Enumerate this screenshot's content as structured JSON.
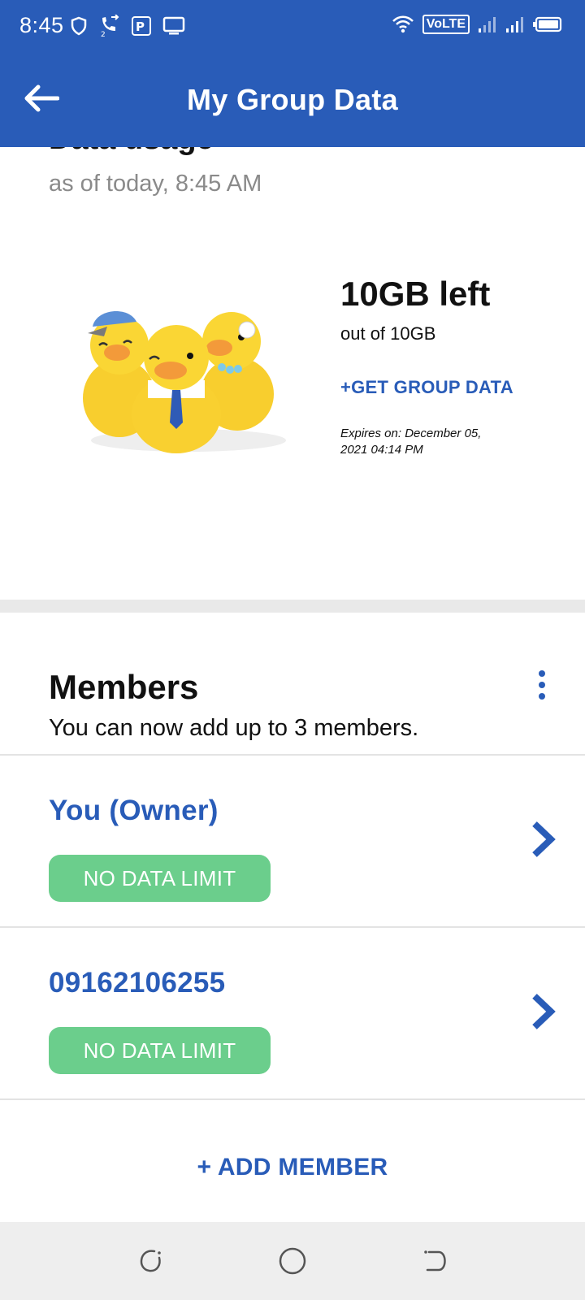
{
  "status_bar": {
    "time": "8:45",
    "left_icons": [
      "shield-icon",
      "call-forward-icon",
      "parking-icon",
      "screen-icon"
    ],
    "volte_label": "VoLTE",
    "right_icons": [
      "wifi-icon",
      "signal-icon",
      "signal-icon",
      "battery-icon"
    ]
  },
  "app_bar": {
    "title": "My Group Data",
    "back_icon": "arrow-left-icon"
  },
  "usage": {
    "heading": "Data usage",
    "as_of": "as of today, 8:45 AM",
    "data_left": "10GB left",
    "out_of": "out of 10GB",
    "get_group_data": "+GET GROUP DATA",
    "expires": "Expires on: December 05, 2021 04:14 PM"
  },
  "members": {
    "title": "Members",
    "subtitle": "You can now add up to 3 members.",
    "items": [
      {
        "name": "You (Owner)",
        "badge": "NO DATA LIMIT"
      },
      {
        "name": "09162106255",
        "badge": "NO DATA LIMIT"
      }
    ],
    "add_member": "+ ADD MEMBER"
  },
  "colors": {
    "brand_blue": "#295CB8",
    "badge_green": "#6BCE8C",
    "muted_text": "#8a8a8a"
  }
}
